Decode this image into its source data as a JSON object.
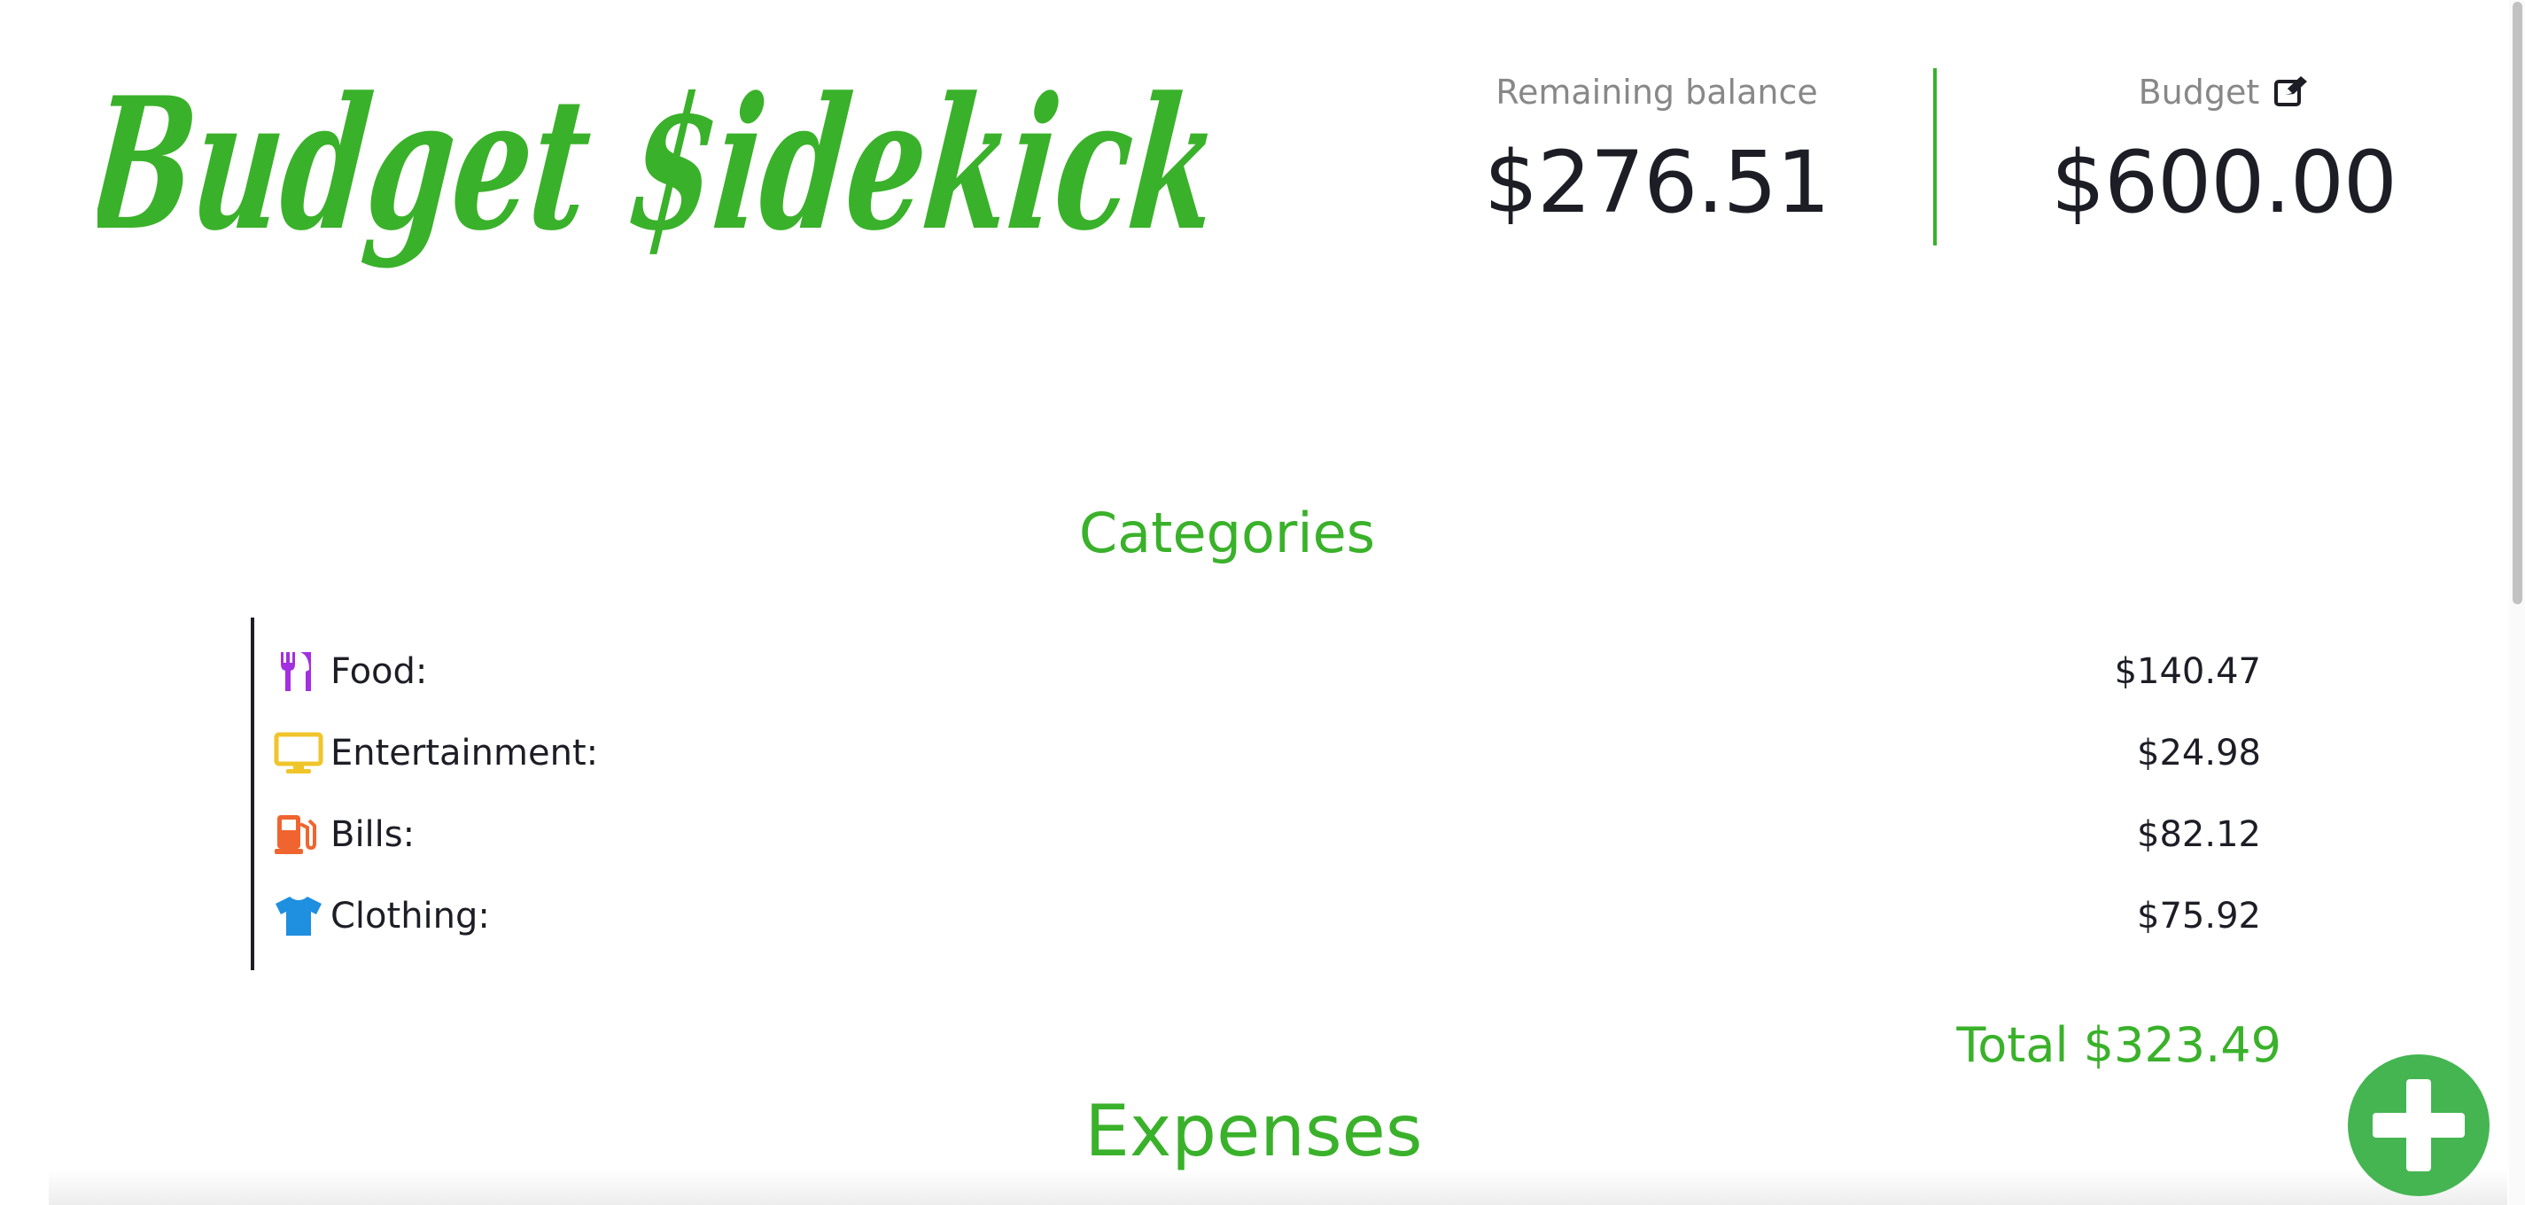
{
  "brand": {
    "logo_text": "Budget $idekick",
    "color": "#3ab12a"
  },
  "header": {
    "remaining": {
      "label": "Remaining balance",
      "amount": "$276.51"
    },
    "budget": {
      "label": "Budget",
      "amount": "$600.00",
      "edit_icon": "edit-icon"
    }
  },
  "categories": {
    "title": "Categories",
    "items": [
      {
        "icon": "utensils-icon",
        "icon_color": "#a330e0",
        "label": "Food:",
        "amount": "$140.47"
      },
      {
        "icon": "monitor-icon",
        "icon_color": "#f0c52a",
        "label": "Entertainment:",
        "amount": "$24.98"
      },
      {
        "icon": "gas-pump-icon",
        "icon_color": "#f0652f",
        "label": "Bills:",
        "amount": "$82.12"
      },
      {
        "icon": "tshirt-icon",
        "icon_color": "#1f8fdf",
        "label": "Clothing:",
        "amount": "$75.92"
      }
    ],
    "total": "Total $323.49"
  },
  "expenses": {
    "title": "Expenses"
  },
  "fab": {
    "icon": "plus-icon",
    "color": "#45b552"
  }
}
